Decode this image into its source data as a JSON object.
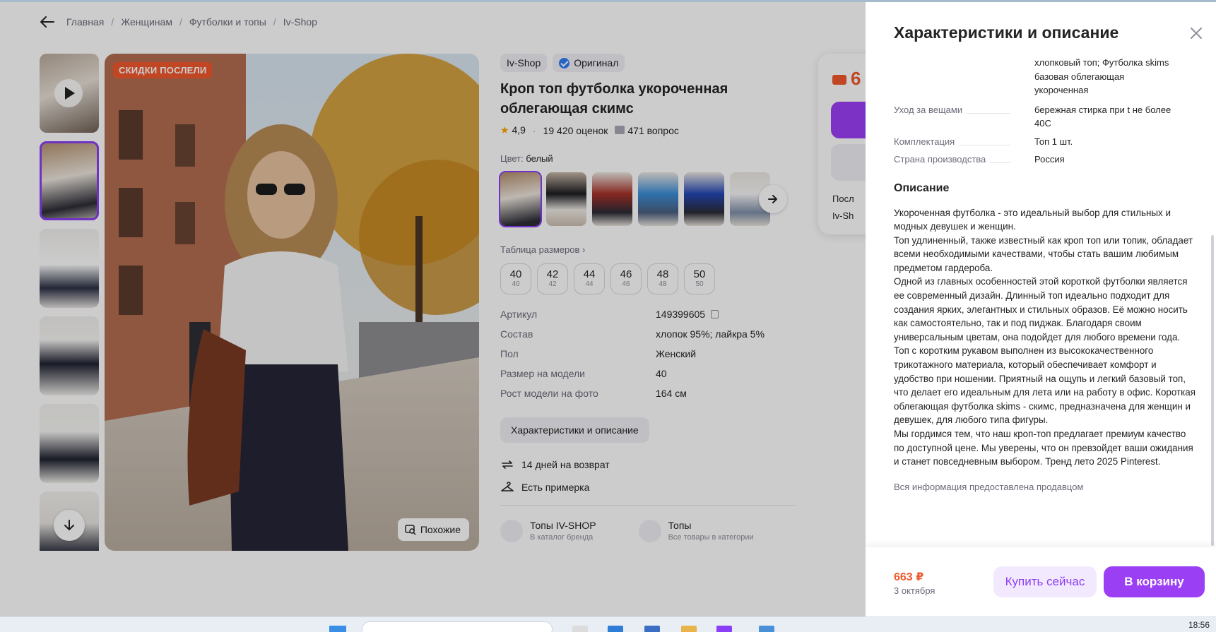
{
  "breadcrumb": [
    "Главная",
    "Женщинам",
    "Футболки и топы",
    "Iv-Shop"
  ],
  "gallery": {
    "sale_badge": "СКИДКИ ПОСЛЕЛИ",
    "similar_label": "Похожие"
  },
  "product": {
    "brand": "Iv-Shop",
    "original_label": "Оригинал",
    "title": "Кроп топ футболка укороченная облегающая скимс",
    "rating": "4,9",
    "reviews": "19 420 оценок",
    "questions": "471 вопрос",
    "color_label": "Цвет:",
    "color_value": "белый",
    "size_table_label": "Таблица размеров",
    "sizes": [
      {
        "n": "40",
        "s": "40"
      },
      {
        "n": "42",
        "s": "42"
      },
      {
        "n": "44",
        "s": "44"
      },
      {
        "n": "46",
        "s": "46"
      },
      {
        "n": "48",
        "s": "48"
      },
      {
        "n": "50",
        "s": "50"
      }
    ],
    "params": [
      {
        "k": "Артикул",
        "v": "149399605"
      },
      {
        "k": "Состав",
        "v": "хлопок 95%; лайкра 5%"
      },
      {
        "k": "Пол",
        "v": "Женский"
      },
      {
        "k": "Размер на модели",
        "v": "40"
      },
      {
        "k": "Рост модели на фото",
        "v": "164 см"
      }
    ],
    "chars_button": "Характеристики и описание",
    "return_label": "14 дней на возврат",
    "fitting_label": "Есть примерка",
    "collections": [
      {
        "title": "Топы IV-SHOP",
        "desc": "В каталог бренда"
      },
      {
        "title": "Топы",
        "desc": "Все товары в категории"
      }
    ]
  },
  "price_card": {
    "price": "6",
    "line1": "Посл",
    "line2": "Iv-Sh"
  },
  "drawer": {
    "title": "Характеристики и описание",
    "rows": [
      {
        "k": "",
        "v": "хлопковый топ; Футболка skims базовая облегающая укороченная"
      },
      {
        "k": "Уход за вещами",
        "v": "бережная стирка при t не более 40С"
      },
      {
        "k": "Комплектация",
        "v": "Топ 1 шт."
      },
      {
        "k": "Страна производства",
        "v": "Россия"
      }
    ],
    "desc_title": "Описание",
    "description": "Укороченная футболка - это идеальный выбор для стильных и модных девушек и женщин.\nТоп удлиненный, также известный как кроп топ или топик, обладает всеми необходимыми качествами, чтобы стать вашим любимым предметом гардероба.\nОдной из главных особенностей этой короткой футболки является ее современный дизайн. Длинный топ идеально подходит для создания ярких, элегантных и стильных образов. Её можно носить как самостоятельно, так и под пиджак. Благодаря своим универсальным цветам, она подойдет для любого времени года.\nТоп с коротким рукавом выполнен из высококачественного трикотажного материала, который обеспечивает комфорт и удобство при ношении. Приятный на ощупь и легкий базовый топ, что делает его идеальным для лета или на работу в офис. Короткая облегающая футболка skims - скимс, предназначена для женщин и девушек, для любого типа фигуры.\nМы гордимся тем, что наш кроп-топ предлагает премиум качество по доступной цене. Мы уверены, что он превзойдет ваши ожидания и станет повседневным выбором. Тренд лето 2025 Pinterest.",
    "seller_note": "Вся информация предоставлена продавцом",
    "footer": {
      "price": "663 ₽",
      "date": "3 октября",
      "buy_now": "Купить сейчас",
      "to_cart": "В корзину"
    }
  },
  "taskbar": {
    "time": "18:56"
  }
}
